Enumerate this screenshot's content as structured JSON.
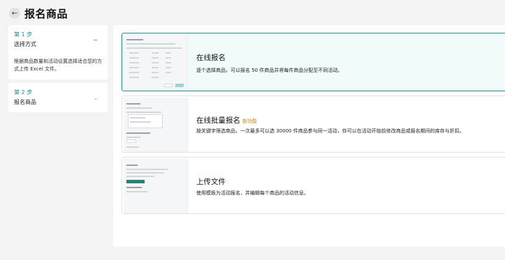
{
  "header": {
    "back_icon": "arrow-left-icon",
    "title": "报名商品"
  },
  "sidebar": {
    "steps": [
      {
        "number": "第 1 步",
        "title": "选择方式",
        "description": "根据商品数量和活动设置选择适合您的方式上传 Excel 文件。",
        "icon": "pencil-icon"
      },
      {
        "number": "第 2 步",
        "title": "报名商品",
        "icon": "chevron-down-icon"
      }
    ]
  },
  "options": [
    {
      "title": "在线报名",
      "badge": "",
      "description": "逐个选择商品，可以报名 50 件商品并将每件商品分配至不同活动。",
      "selected": true
    },
    {
      "title": "在线批量报名",
      "badge": "新功能",
      "description": "按关键字筛选商品，一次最多可以选 30000 件商品参与同一活动，你可以在活动开始前修改商品或报名期间的库存与折扣。",
      "selected": false
    },
    {
      "title": "上传文件",
      "badge": "",
      "description": "使用模板为活动报名，并编辑每个商品的活动信息。",
      "selected": false
    }
  ],
  "colors": {
    "accent": "#2a8a8f",
    "selected_bg": "#f1fbfa",
    "badge": "#c98a12",
    "page_bg": "#f4f4f5"
  }
}
